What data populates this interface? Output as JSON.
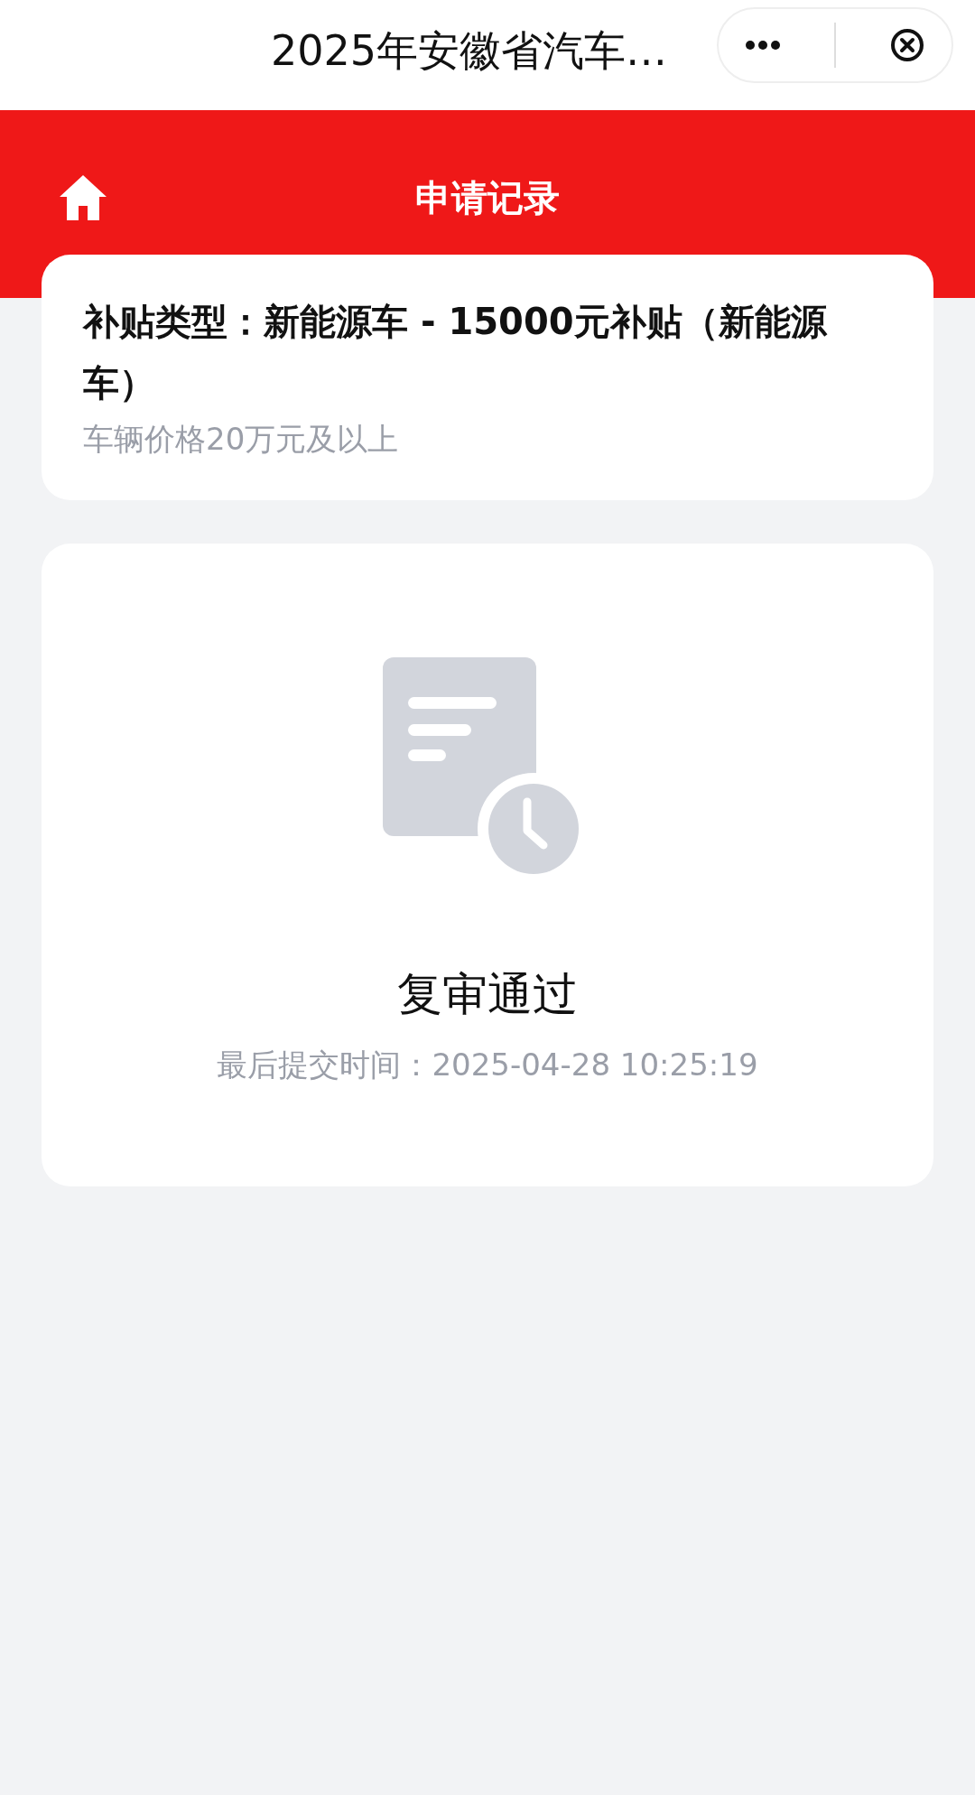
{
  "window": {
    "title": "2025年安徽省汽车…"
  },
  "header": {
    "title": "申请记录"
  },
  "subsidy": {
    "type": "补贴类型：新能源车 - 15000元补贴（新能源车）",
    "condition": "车辆价格20万元及以上"
  },
  "record": {
    "status": "复审通过",
    "submitted": "最后提交时间：2025-04-28 10:25:19"
  }
}
